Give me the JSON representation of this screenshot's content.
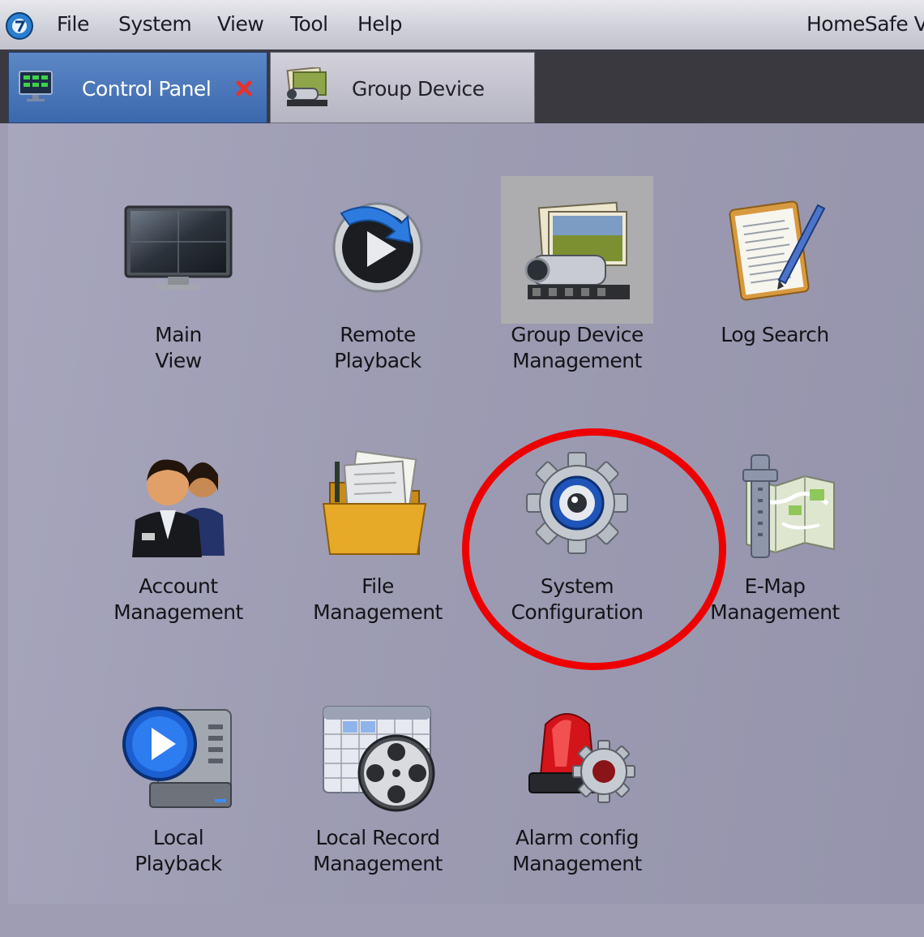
{
  "menubar": {
    "items": [
      "File",
      "System",
      "View",
      "Tool",
      "Help"
    ],
    "app_title": "HomeSafe V"
  },
  "tabs": [
    {
      "label": "Control Panel",
      "active": true,
      "closable": true,
      "icon": "control-panel-icon"
    },
    {
      "label": "Group Device",
      "active": false,
      "closable": false,
      "icon": "group-device-icon"
    }
  ],
  "panel": {
    "tiles": [
      {
        "id": "main-view",
        "line1": "Main",
        "line2": "View",
        "icon": "monitor-icon"
      },
      {
        "id": "remote-playback",
        "line1": "Remote",
        "line2": "Playback",
        "icon": "remote-playback-icon"
      },
      {
        "id": "group-device-management",
        "line1": "Group Device",
        "line2": "Management",
        "icon": "camera-photos-icon",
        "highlighted": true
      },
      {
        "id": "log-search",
        "line1": "Log Search",
        "line2": "",
        "icon": "clipboard-pen-icon"
      },
      {
        "id": "account-management",
        "line1": "Account",
        "line2": "Management",
        "icon": "users-icon"
      },
      {
        "id": "file-management",
        "line1": "File",
        "line2": "Management",
        "icon": "folder-icon"
      },
      {
        "id": "system-configuration",
        "line1": "System",
        "line2": "Configuration",
        "icon": "gear-icon",
        "annotated": true
      },
      {
        "id": "e-map-management",
        "line1": "E-Map",
        "line2": "Management",
        "icon": "map-icon"
      },
      {
        "id": "local-playback",
        "line1": "Local",
        "line2": "Playback",
        "icon": "local-playback-icon"
      },
      {
        "id": "local-record-management",
        "line1": "Local Record",
        "line2": "Management",
        "icon": "film-reel-calendar-icon"
      },
      {
        "id": "alarm-config-management",
        "line1": "Alarm config",
        "line2": "Management",
        "icon": "alarm-siren-icon"
      }
    ]
  },
  "colors": {
    "background": "#9e9db3",
    "active_tab": "#4b78ba",
    "annotation": "#ee0000"
  }
}
